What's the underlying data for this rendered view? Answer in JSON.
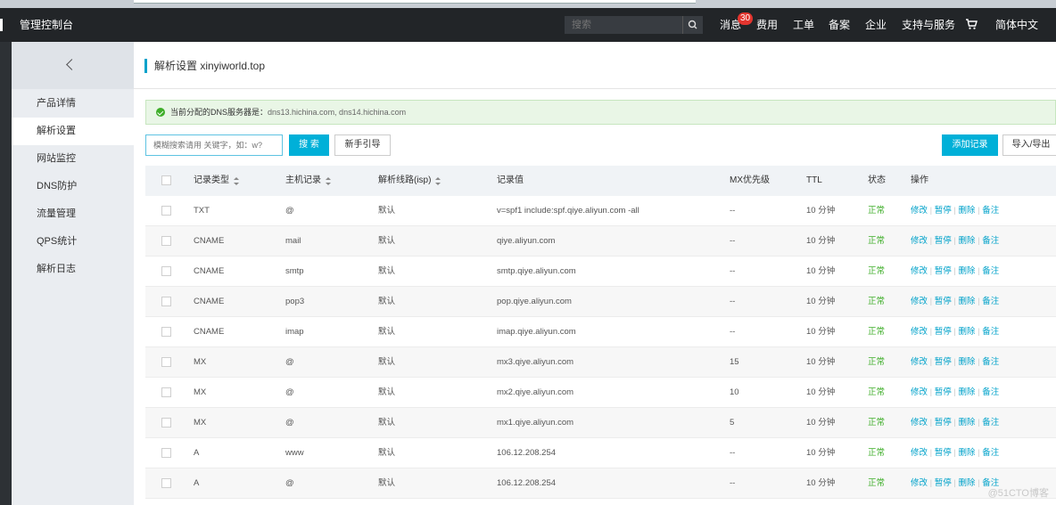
{
  "topbar": {
    "brand": "管理控制台",
    "search_placeholder": "搜索",
    "nav": [
      {
        "label": "消息",
        "badge": "30"
      },
      {
        "label": "费用"
      },
      {
        "label": "工单"
      },
      {
        "label": "备案"
      },
      {
        "label": "企业"
      },
      {
        "label": "支持与服务"
      },
      {
        "label": "简体中文"
      }
    ]
  },
  "sidebar": {
    "items": [
      "产品详情",
      "解析设置",
      "网站监控",
      "DNS防护",
      "流量管理",
      "QPS统计",
      "解析日志"
    ],
    "active_index": 1
  },
  "page": {
    "title": "解析设置 xinyiworld.top",
    "notice_label": "当前分配的DNS服务器是：",
    "notice_value": "dns13.hichina.com, dns14.hichina.com",
    "search_placeholder": "模糊搜索请用 关键字，如：w?",
    "search_button": "搜 索",
    "guide_button": "新手引导",
    "add_button": "添加记录",
    "import_button": "导入/导出"
  },
  "table": {
    "headers": [
      "记录类型",
      "主机记录",
      "解析线路(isp)",
      "记录值",
      "MX优先级",
      "TTL",
      "状态",
      "操作"
    ],
    "actions": [
      "修改",
      "暂停",
      "删除",
      "备注"
    ],
    "rows": [
      {
        "type": "TXT",
        "host": "@",
        "line": "默认",
        "value": "v=spf1 include:spf.qiye.aliyun.com -all",
        "mx": "--",
        "ttl": "10 分钟",
        "status": "正常"
      },
      {
        "type": "CNAME",
        "host": "mail",
        "line": "默认",
        "value": "qiye.aliyun.com",
        "mx": "--",
        "ttl": "10 分钟",
        "status": "正常"
      },
      {
        "type": "CNAME",
        "host": "smtp",
        "line": "默认",
        "value": "smtp.qiye.aliyun.com",
        "mx": "--",
        "ttl": "10 分钟",
        "status": "正常"
      },
      {
        "type": "CNAME",
        "host": "pop3",
        "line": "默认",
        "value": "pop.qiye.aliyun.com",
        "mx": "--",
        "ttl": "10 分钟",
        "status": "正常"
      },
      {
        "type": "CNAME",
        "host": "imap",
        "line": "默认",
        "value": "imap.qiye.aliyun.com",
        "mx": "--",
        "ttl": "10 分钟",
        "status": "正常"
      },
      {
        "type": "MX",
        "host": "@",
        "line": "默认",
        "value": "mx3.qiye.aliyun.com",
        "mx": "15",
        "ttl": "10 分钟",
        "status": "正常"
      },
      {
        "type": "MX",
        "host": "@",
        "line": "默认",
        "value": "mx2.qiye.aliyun.com",
        "mx": "10",
        "ttl": "10 分钟",
        "status": "正常"
      },
      {
        "type": "MX",
        "host": "@",
        "line": "默认",
        "value": "mx1.qiye.aliyun.com",
        "mx": "5",
        "ttl": "10 分钟",
        "status": "正常"
      },
      {
        "type": "A",
        "host": "www",
        "line": "默认",
        "value": "106.12.208.254",
        "mx": "--",
        "ttl": "10 分钟",
        "status": "正常"
      },
      {
        "type": "A",
        "host": "@",
        "line": "默认",
        "value": "106.12.208.254",
        "mx": "--",
        "ttl": "10 分钟",
        "status": "正常"
      }
    ]
  },
  "watermark": "@51CTO博客"
}
